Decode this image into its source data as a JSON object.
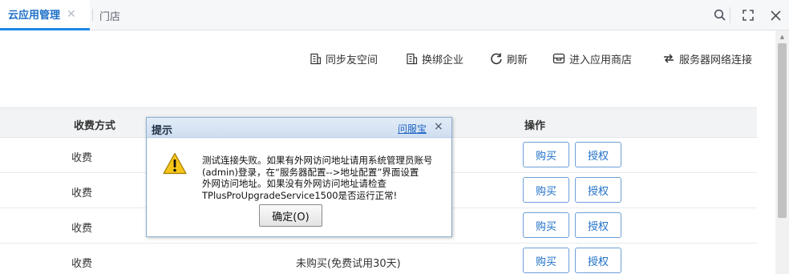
{
  "tabs": [
    {
      "label": "云应用管理",
      "active": true
    },
    {
      "label": "门店",
      "active": false
    }
  ],
  "window_controls": [
    "search-icon",
    "expand-icon",
    "close-icon"
  ],
  "toolbar": {
    "sync_label": "同步友空间",
    "rebind_label": "换绑企业",
    "refresh_label": "刷新",
    "store_label": "进入应用商店",
    "network_label": "服务器网络连接"
  },
  "table": {
    "columns": {
      "fee": "收费方式",
      "operation": "操作"
    },
    "rows": [
      {
        "fee": "收费",
        "status": ""
      },
      {
        "fee": "收费",
        "status": ""
      },
      {
        "fee": "收费",
        "status": ""
      },
      {
        "fee": "收费",
        "status": "未购买(免费试用30天)"
      }
    ],
    "buy_label": "购买",
    "auth_label": "授权"
  },
  "dialog": {
    "title": "提示",
    "help_link": "问服宝",
    "close": "×",
    "message": "测试连接失败。如果有外网访问地址请用系统管理员账号\n(admin)登录，在“服务器配置-->地址配置”界面设置\n外网访问地址。如果没有外网访问地址请检查\nTPlusProUpgradeService1500是否运行正常!",
    "ok_label": "确定(O)"
  },
  "colors": {
    "accent": "#1e88e5",
    "link": "#1e63c4",
    "button_border": "#6d9fd6"
  }
}
